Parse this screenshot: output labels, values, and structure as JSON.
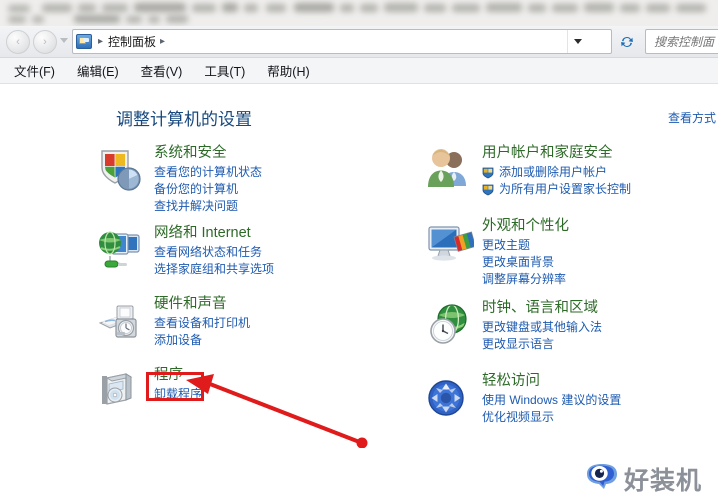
{
  "window": {
    "blurred_header_note": ""
  },
  "navbar": {
    "back_label": "‹",
    "forward_label": "›",
    "cp_icon_name": "control-panel-icon",
    "breadcrumb": "控制面板",
    "separator": "▸",
    "dropdown_icon": "chevron-down-icon",
    "refresh_icon": "↻",
    "search_placeholder": "搜索控制面"
  },
  "menubar": {
    "items": [
      {
        "label": "文件(F)"
      },
      {
        "label": "编辑(E)"
      },
      {
        "label": "查看(V)"
      },
      {
        "label": "工具(T)"
      },
      {
        "label": "帮助(H)"
      }
    ]
  },
  "content": {
    "page_title": "调整计算机的设置",
    "view_by_label": "查看方式"
  },
  "categories_left": [
    {
      "icon": "shield-pie-icon",
      "title": "系统和安全",
      "links": [
        {
          "text": "查看您的计算机状态",
          "shield": false
        },
        {
          "text": "备份您的计算机",
          "shield": false
        },
        {
          "text": "查找并解决问题",
          "shield": false
        }
      ]
    },
    {
      "icon": "globe-monitor-icon",
      "title": "网络和 Internet",
      "links": [
        {
          "text": "查看网络状态和任务",
          "shield": false
        },
        {
          "text": "选择家庭组和共享选项",
          "shield": false
        }
      ]
    },
    {
      "icon": "printer-speaker-icon",
      "title": "硬件和声音",
      "links": [
        {
          "text": "查看设备和打印机",
          "shield": false
        },
        {
          "text": "添加设备",
          "shield": false
        }
      ]
    },
    {
      "icon": "software-box-cd-icon",
      "title": "程序",
      "links": [
        {
          "text": "卸载程序",
          "shield": false
        }
      ]
    }
  ],
  "categories_right": [
    {
      "icon": "two-users-icon",
      "title": "用户帐户和家庭安全",
      "links": [
        {
          "text": "添加或删除用户帐户",
          "shield": true
        },
        {
          "text": "为所有用户设置家长控制",
          "shield": true
        }
      ]
    },
    {
      "icon": "monitor-palette-icon",
      "title": "外观和个性化",
      "links": [
        {
          "text": "更改主题",
          "shield": false
        },
        {
          "text": "更改桌面背景",
          "shield": false
        },
        {
          "text": "调整屏幕分辨率",
          "shield": false
        }
      ]
    },
    {
      "icon": "clock-globe-icon",
      "title": "时钟、语言和区域",
      "links": [
        {
          "text": "更改键盘或其他输入法",
          "shield": false
        },
        {
          "text": "更改显示语言",
          "shield": false
        }
      ]
    },
    {
      "icon": "ease-of-access-icon",
      "title": "轻松访问",
      "links": [
        {
          "text": "使用 Windows 建议的设置",
          "shield": false
        },
        {
          "text": "优化视频显示",
          "shield": false
        }
      ]
    }
  ],
  "annotation": {
    "highlight_target": "程序",
    "box_color": "#e01b1b",
    "arrow_color": "#e01b1b",
    "arrow_icon": "red-arrow-annotation"
  },
  "watermark": {
    "text": "好装机",
    "logo_icon": "haozhuangji-logo-icon",
    "logo_color": "#2f5fd0",
    "text_color": "#8c9099"
  },
  "theme": {
    "title_color": "#17487d",
    "category_title_color": "#2d6a28",
    "link_color": "#1e5bb0",
    "chrome_top": "#f3f4f6",
    "chrome_bottom": "#e6e8ec"
  }
}
